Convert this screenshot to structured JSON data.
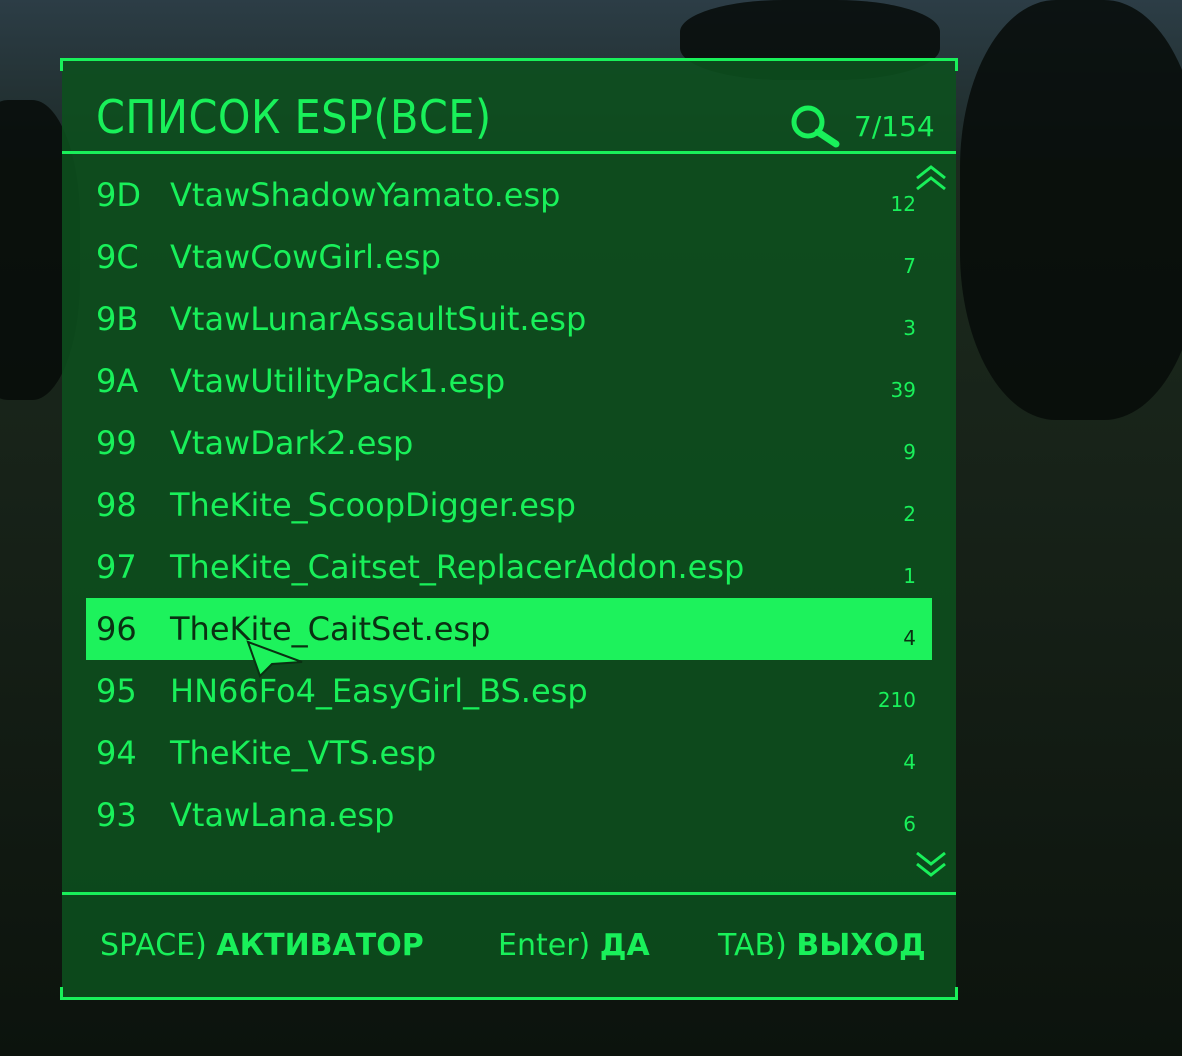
{
  "header": {
    "title": "СПИСОК ESP(ВСЕ)",
    "count": "7/154"
  },
  "list": [
    {
      "idx": "9D",
      "name": "VtawShadowYamato.esp",
      "num": "12",
      "selected": false
    },
    {
      "idx": "9C",
      "name": "VtawCowGirl.esp",
      "num": "7",
      "selected": false
    },
    {
      "idx": "9B",
      "name": "VtawLunarAssaultSuit.esp",
      "num": "3",
      "selected": false
    },
    {
      "idx": "9A",
      "name": "VtawUtilityPack1.esp",
      "num": "39",
      "selected": false
    },
    {
      "idx": "99",
      "name": "VtawDark2.esp",
      "num": "9",
      "selected": false
    },
    {
      "idx": "98",
      "name": "TheKite_ScoopDigger.esp",
      "num": "2",
      "selected": false
    },
    {
      "idx": "97",
      "name": "TheKite_Caitset_ReplacerAddon.esp",
      "num": "1",
      "selected": false
    },
    {
      "idx": "96",
      "name": "TheKite_CaitSet.esp",
      "num": "4",
      "selected": true
    },
    {
      "idx": "95",
      "name": "HN66Fo4_EasyGirl_BS.esp",
      "num": "210",
      "selected": false
    },
    {
      "idx": "94",
      "name": "TheKite_VTS.esp",
      "num": "4",
      "selected": false
    },
    {
      "idx": "93",
      "name": "VtawLana.esp",
      "num": "6",
      "selected": false
    }
  ],
  "footer": {
    "space_key": "SPACE)",
    "space_label": "АКТИВАТОР",
    "enter_key": "Enter)",
    "enter_label": "ДА",
    "tab_key": "TAB)",
    "tab_label": "ВЫХОД"
  },
  "colors": {
    "accent": "#19f05a",
    "panel": "#0c501e",
    "selected_bg": "#1df25c",
    "selected_text": "#0a3012"
  },
  "icons": [
    "search-icon",
    "chevron-up-icon",
    "chevron-down-icon",
    "mouse-cursor-icon"
  ]
}
